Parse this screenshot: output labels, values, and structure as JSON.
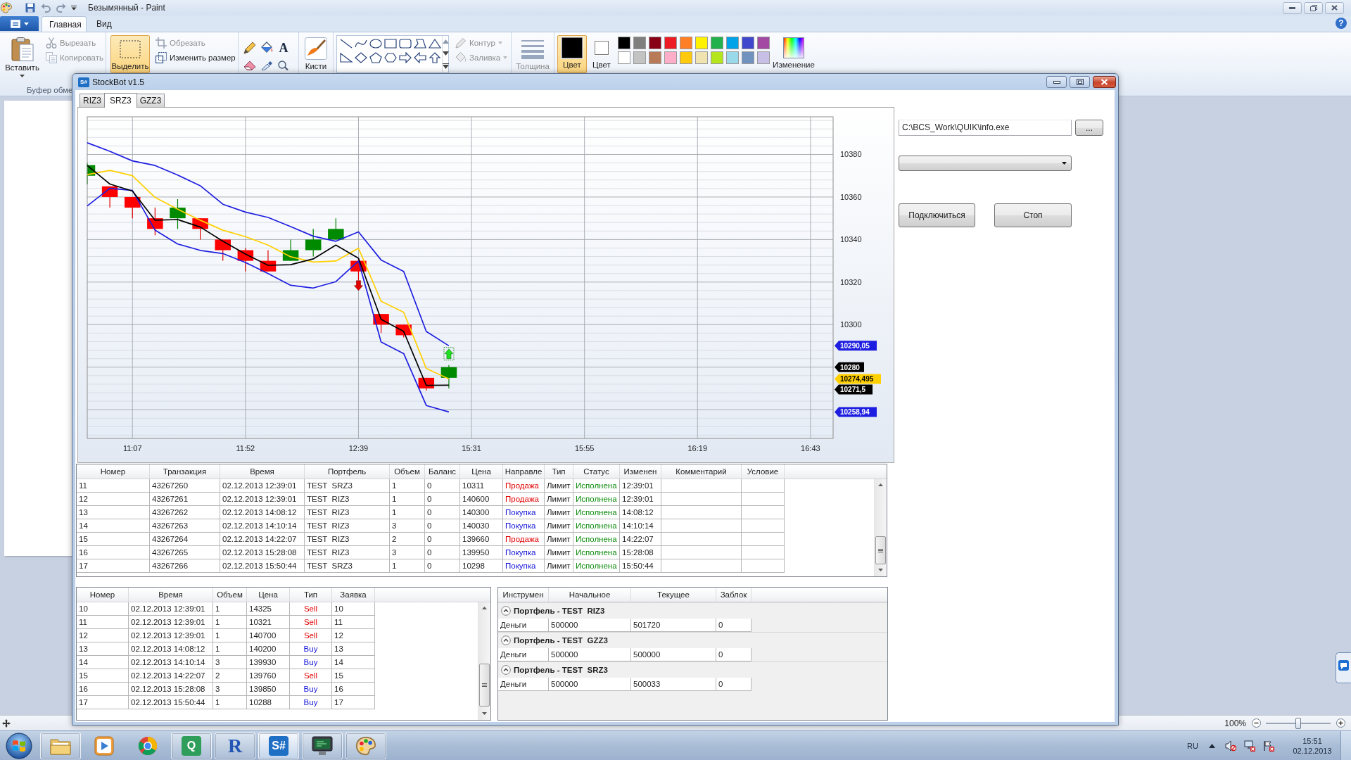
{
  "paint": {
    "title": "Безымянный - Paint",
    "help": "?",
    "tabs": [
      {
        "label": "Главная",
        "selected": true
      },
      {
        "label": "Вид",
        "selected": false
      }
    ],
    "paste": "Вставить",
    "clipboard_items": [
      {
        "label": "Вырезать",
        "disabled": true
      },
      {
        "label": "Копировать",
        "disabled": true
      }
    ],
    "clipboard_group": "Буфер обме",
    "select": {
      "label": "Выделить",
      "selected": true
    },
    "image_items": [
      {
        "label": "Обрезать",
        "disabled": true
      },
      {
        "label": "Изменить размер",
        "disabled": false
      }
    ],
    "text_tool": "A",
    "brushes": "Кисти",
    "shape_options": [
      {
        "label": "Контур",
        "disabled": true
      },
      {
        "label": "Заливка",
        "disabled": true
      }
    ],
    "size": {
      "label": "Толщина",
      "disabled": true
    },
    "colors": [
      {
        "label": "Цвет",
        "selected": true,
        "color": "#000000"
      },
      {
        "label": "Цвет",
        "selected": false,
        "color": "#ffffff"
      }
    ],
    "palette": [
      {
        "color": "#000000"
      },
      {
        "color": "#7f7f7f"
      },
      {
        "color": "#880015"
      },
      {
        "color": "#ed1c24"
      },
      {
        "color": "#ff7f27"
      },
      {
        "color": "#fff200"
      },
      {
        "color": "#22b14c"
      },
      {
        "color": "#00a2e8"
      },
      {
        "color": "#3f48cc"
      },
      {
        "color": "#a349a4"
      },
      {
        "color": "#ffffff"
      },
      {
        "color": "#c3c3c3"
      },
      {
        "color": "#b97a57"
      },
      {
        "color": "#ffaec9"
      },
      {
        "color": "#ffc90e"
      },
      {
        "color": "#efe4b0"
      },
      {
        "color": "#b5e61d"
      },
      {
        "color": "#99d9ea"
      },
      {
        "color": "#7092be"
      },
      {
        "color": "#c8bfe7"
      }
    ],
    "edit_colors": "Изменение",
    "status": {
      "zoom": "100%",
      "level": 0.5
    }
  },
  "window": {
    "title": "StockBot v1.5",
    "icon_text": "S#",
    "tabs": [
      {
        "label": "RIZ3",
        "selected": false
      },
      {
        "label": "SRZ3",
        "selected": true
      },
      {
        "label": "GZZ3",
        "selected": false
      }
    ],
    "chart": {
      "chart_data": {
        "type": "line",
        "grid": true,
        "categories": [
          null,
          null,
          "11:07",
          null,
          null,
          null,
          null,
          "11:52",
          null,
          null,
          null,
          null,
          "12:39",
          null,
          null,
          null,
          null,
          "15:31",
          null,
          null,
          null,
          null,
          "15:55",
          null,
          null,
          null,
          null,
          "16:19",
          null,
          null,
          null,
          null,
          "16:43"
        ],
        "ylim": [
          10246.5,
          10397.7
        ],
        "yticks": [
          10300,
          10320,
          10340,
          10360,
          10380
        ],
        "series": [
          {
            "color": "#1e1ee0",
            "values": [
              10385.5,
              10381.5,
              10377.0,
              10374.8,
              10370.3,
              10365.3,
              10356.6,
              10352.9,
              10350.4,
              10346.1,
              10341.6,
              10339.2,
              10343.6,
              10330.4,
              10325.0,
              10296.8,
              10290.05,
              null,
              null,
              null,
              null,
              null,
              null,
              null,
              null,
              null,
              null,
              null,
              null,
              null,
              null,
              null,
              null
            ]
          },
          {
            "color": "#1e1ee0",
            "values": [
              10355.8,
              10364.1,
              10363.1,
              10344.4,
              10337.9,
              10334.9,
              10333.4,
              10329.2,
              10324.0,
              10318.5,
              10317.2,
              10320.2,
              10329.9,
              10291.8,
              10286.4,
              10262.0,
              10258.94,
              null,
              null,
              null,
              null,
              null,
              null,
              null,
              null,
              null,
              null,
              null,
              null,
              null,
              null,
              null,
              null
            ]
          },
          {
            "color": "#ffd000",
            "values": [
              10370.5,
              10372.5,
              10370.0,
              10359.8,
              10354.3,
              10349.1,
              10344.4,
              10341.4,
              10337.4,
              10331.9,
              10329.4,
              10329.9,
              10335.9,
              10311.0,
              10305.8,
              10279.4,
              10274.495,
              null,
              null,
              null,
              null,
              null,
              null,
              null,
              null,
              null,
              null,
              null,
              null,
              null,
              null,
              null,
              null
            ]
          },
          {
            "color": "#000000",
            "values": [
              10374.8,
              10366.1,
              10362.8,
              10349.1,
              10349.4,
              10345.9,
              10339.2,
              10333.2,
              10327.9,
              10328.2,
              10330.9,
              10337.4,
              10331.2,
              10302.5,
              10296.8,
              10271.4,
              10271.5,
              null,
              null,
              null,
              null,
              null,
              null,
              null,
              null,
              null,
              null,
              null,
              null,
              null,
              null,
              null,
              null
            ]
          }
        ],
        "annotations": [
          "10290,05",
          "10280",
          "10274,495",
          "10271,5",
          "10258,94"
        ]
      }
    },
    "path": {
      "value": "C:\\BCS_Work\\QUIK\\info.exe"
    },
    "browse": "...",
    "connect": "Подключиться",
    "stop": "Стоп",
    "orders": {
      "columns": [
        "Номер",
        "Транзакция",
        "Время",
        "Портфель",
        "Объем",
        "Баланс",
        "Цена",
        "Направле",
        "Тип",
        "Статус",
        "Изменен",
        "Комментарий",
        "Условие"
      ],
      "rows": [
        {
          "kind": "sell",
          "cells": [
            "11",
            "43267260",
            "02.12.2013 12:39:01",
            "TEST  SRZ3",
            "1",
            "0",
            "10311",
            "Продажа",
            "Лимит",
            "Исполнена",
            "12:39:01"
          ]
        },
        {
          "kind": "sell",
          "cells": [
            "12",
            "43267261",
            "02.12.2013 12:39:01",
            "TEST  RIZ3",
            "1",
            "0",
            "140600",
            "Продажа",
            "Лимит",
            "Исполнена",
            "12:39:01"
          ]
        },
        {
          "kind": "buy",
          "cells": [
            "13",
            "43267262",
            "02.12.2013 14:08:12",
            "TEST  RIZ3",
            "1",
            "0",
            "140300",
            "Покупка",
            "Лимит",
            "Исполнена",
            "14:08:12"
          ]
        },
        {
          "kind": "buy",
          "cells": [
            "14",
            "43267263",
            "02.12.2013 14:10:14",
            "TEST  RIZ3",
            "3",
            "0",
            "140030",
            "Покупка",
            "Лимит",
            "Исполнена",
            "14:10:14"
          ]
        },
        {
          "kind": "sell",
          "cells": [
            "15",
            "43267264",
            "02.12.2013 14:22:07",
            "TEST  RIZ3",
            "2",
            "0",
            "139660",
            "Продажа",
            "Лимит",
            "Исполнена",
            "14:22:07"
          ]
        },
        {
          "kind": "buy",
          "cells": [
            "16",
            "43267265",
            "02.12.2013 15:28:08",
            "TEST  RIZ3",
            "3",
            "0",
            "139950",
            "Покупка",
            "Лимит",
            "Исполнена",
            "15:28:08"
          ]
        },
        {
          "kind": "buy",
          "cells": [
            "17",
            "43267266",
            "02.12.2013 15:50:44",
            "TEST  SRZ3",
            "1",
            "0",
            "10298",
            "Покупка",
            "Лимит",
            "Исполнена",
            "15:50:44"
          ]
        }
      ]
    },
    "trades": {
      "columns": [
        "Номер",
        "Время",
        "Объем",
        "Цена",
        "Тип",
        "Заявка"
      ],
      "rows": [
        {
          "kind": "sell",
          "cells": [
            "10",
            "02.12.2013 12:39:01",
            "1",
            "14325",
            "Sell",
            "10"
          ]
        },
        {
          "kind": "sell",
          "cells": [
            "11",
            "02.12.2013 12:39:01",
            "1",
            "10321",
            "Sell",
            "11"
          ]
        },
        {
          "kind": "sell",
          "cells": [
            "12",
            "02.12.2013 12:39:01",
            "1",
            "140700",
            "Sell",
            "12"
          ]
        },
        {
          "kind": "buy",
          "cells": [
            "13",
            "02.12.2013 14:08:12",
            "1",
            "140200",
            "Buy",
            "13"
          ]
        },
        {
          "kind": "buy",
          "cells": [
            "14",
            "02.12.2013 14:10:14",
            "3",
            "139930",
            "Buy",
            "14"
          ]
        },
        {
          "kind": "sell",
          "cells": [
            "15",
            "02.12.2013 14:22:07",
            "2",
            "139760",
            "Sell",
            "15"
          ]
        },
        {
          "kind": "buy",
          "cells": [
            "16",
            "02.12.2013 15:28:08",
            "3",
            "139850",
            "Buy",
            "16"
          ]
        },
        {
          "kind": "buy",
          "cells": [
            "17",
            "02.12.2013 15:50:44",
            "1",
            "10288",
            "Buy",
            "17"
          ]
        }
      ]
    },
    "portfolio": {
      "columns": [
        "Инструмен",
        "Начальное",
        "Текущее",
        "Заблок"
      ],
      "groups": [
        {
          "title": "Портфель - TEST  RIZ3",
          "expanded": true,
          "rows": [
            [
              "Деньги",
              "500000",
              "501720",
              "0"
            ]
          ]
        },
        {
          "title": "Портфель - TEST  GZZ3",
          "expanded": true,
          "rows": [
            [
              "Деньги",
              "500000",
              "500000",
              "0"
            ]
          ]
        },
        {
          "title": "Портфель - TEST  SRZ3",
          "expanded": true,
          "rows": [
            [
              "Деньги",
              "500000",
              "500033",
              "0"
            ]
          ]
        }
      ]
    }
  },
  "taskbar": {
    "apps": [
      {
        "kind": "folder",
        "running": true,
        "selected": false
      },
      {
        "kind": "media",
        "running": false,
        "selected": false
      },
      {
        "kind": "browser",
        "running": false,
        "selected": false
      },
      {
        "kind": "tile",
        "label": "Q",
        "color": "#2f9e5a",
        "running": true,
        "selected": false
      },
      {
        "kind": "letter",
        "label": "R",
        "color": "#2456b4",
        "running": true,
        "selected": false
      },
      {
        "kind": "tile",
        "label": "S#",
        "color": "#1f6fc5",
        "running": true,
        "selected": true
      },
      {
        "kind": "monitor",
        "running": true,
        "selected": false
      },
      {
        "kind": "paint",
        "running": true,
        "selected": false
      }
    ],
    "language": "RU",
    "time": "15:51",
    "date": "02.12.2013"
  }
}
